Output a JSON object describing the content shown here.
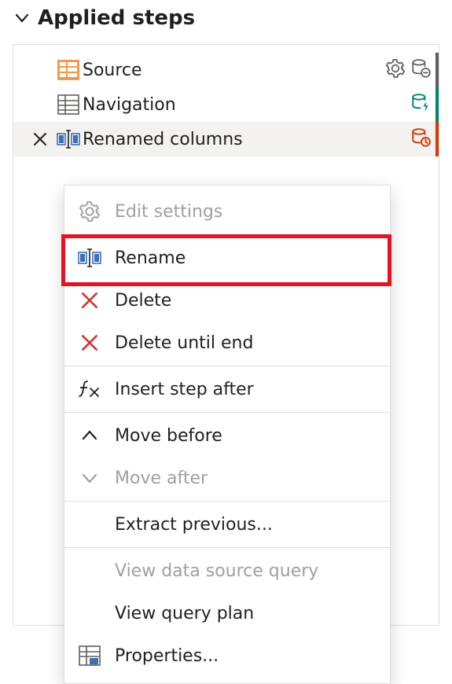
{
  "header": {
    "title": "Applied steps"
  },
  "steps": [
    {
      "label": "Source"
    },
    {
      "label": "Navigation"
    },
    {
      "label": "Renamed columns"
    }
  ],
  "menu": {
    "edit_settings": "Edit settings",
    "rename": "Rename",
    "delete": "Delete",
    "delete_until_end": "Delete until end",
    "insert_step_after": "Insert step after",
    "move_before": "Move before",
    "move_after": "Move after",
    "extract_previous": "Extract previous...",
    "view_data_source_query": "View data source query",
    "view_query_plan": "View query plan",
    "properties": "Properties..."
  },
  "colors": {
    "selected_bg": "#f3f2f1",
    "accent_orange": "#d83b01",
    "teal": "#008575",
    "disabled": "#a19f9d",
    "highlight": "#e81123"
  }
}
